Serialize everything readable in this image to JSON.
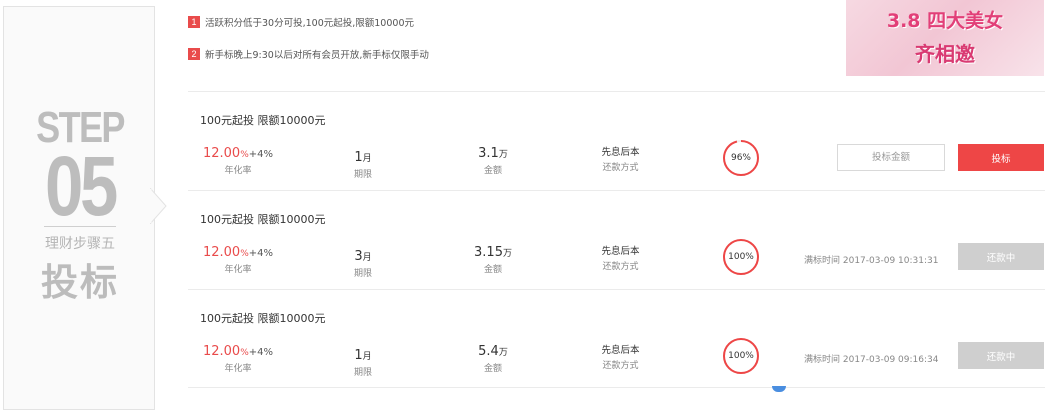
{
  "step": {
    "label": "STEP",
    "number": "05",
    "subtitle": "理财步骤五",
    "title": "投标"
  },
  "rules": [
    {
      "num": "1",
      "text": "活跃积分低于30分可投,100元起投,限额10000元"
    },
    {
      "num": "2",
      "text": "新手标晚上9:30以后对所有会员开放,新手标仅限手动"
    }
  ],
  "banner": {
    "line1": "3.8 四大美女",
    "line2": "齐相邀"
  },
  "labels": {
    "rate": "年化率",
    "period": "期限",
    "amount": "金额",
    "repay": "还款方式",
    "full_time_prefix": "满标时间"
  },
  "products": [
    {
      "title": "100元起投 限额10000元",
      "rate": "12.00",
      "rate_pct": "%",
      "bonus": "+4%",
      "period_num": "1",
      "period_unit": "月",
      "amount_num": "3.1",
      "amount_unit": "万",
      "repay": "先息后本",
      "progress_text": "96%",
      "progress": 0.96,
      "input_placeholder": "投标金额",
      "button": "投标",
      "status": "open"
    },
    {
      "title": "100元起投 限额10000元",
      "rate": "12.00",
      "rate_pct": "%",
      "bonus": "+4%",
      "period_num": "3",
      "period_unit": "月",
      "amount_num": "3.15",
      "amount_unit": "万",
      "repay": "先息后本",
      "progress_text": "100%",
      "progress": 1.0,
      "full_time": "满标时间 2017-03-09 10:31:31",
      "button": "还款中",
      "status": "repaying"
    },
    {
      "title": "100元起投 限额10000元",
      "rate": "12.00",
      "rate_pct": "%",
      "bonus": "+4%",
      "period_num": "1",
      "period_unit": "月",
      "amount_num": "5.4",
      "amount_unit": "万",
      "repay": "先息后本",
      "progress_text": "100%",
      "progress": 1.0,
      "full_time": "满标时间 2017-03-09 09:16:34",
      "button": "还款中",
      "status": "repaying"
    }
  ],
  "colors": {
    "accent": "#ee4646",
    "disabled": "#cfcfcf",
    "step_gray": "#bdbdbd"
  }
}
